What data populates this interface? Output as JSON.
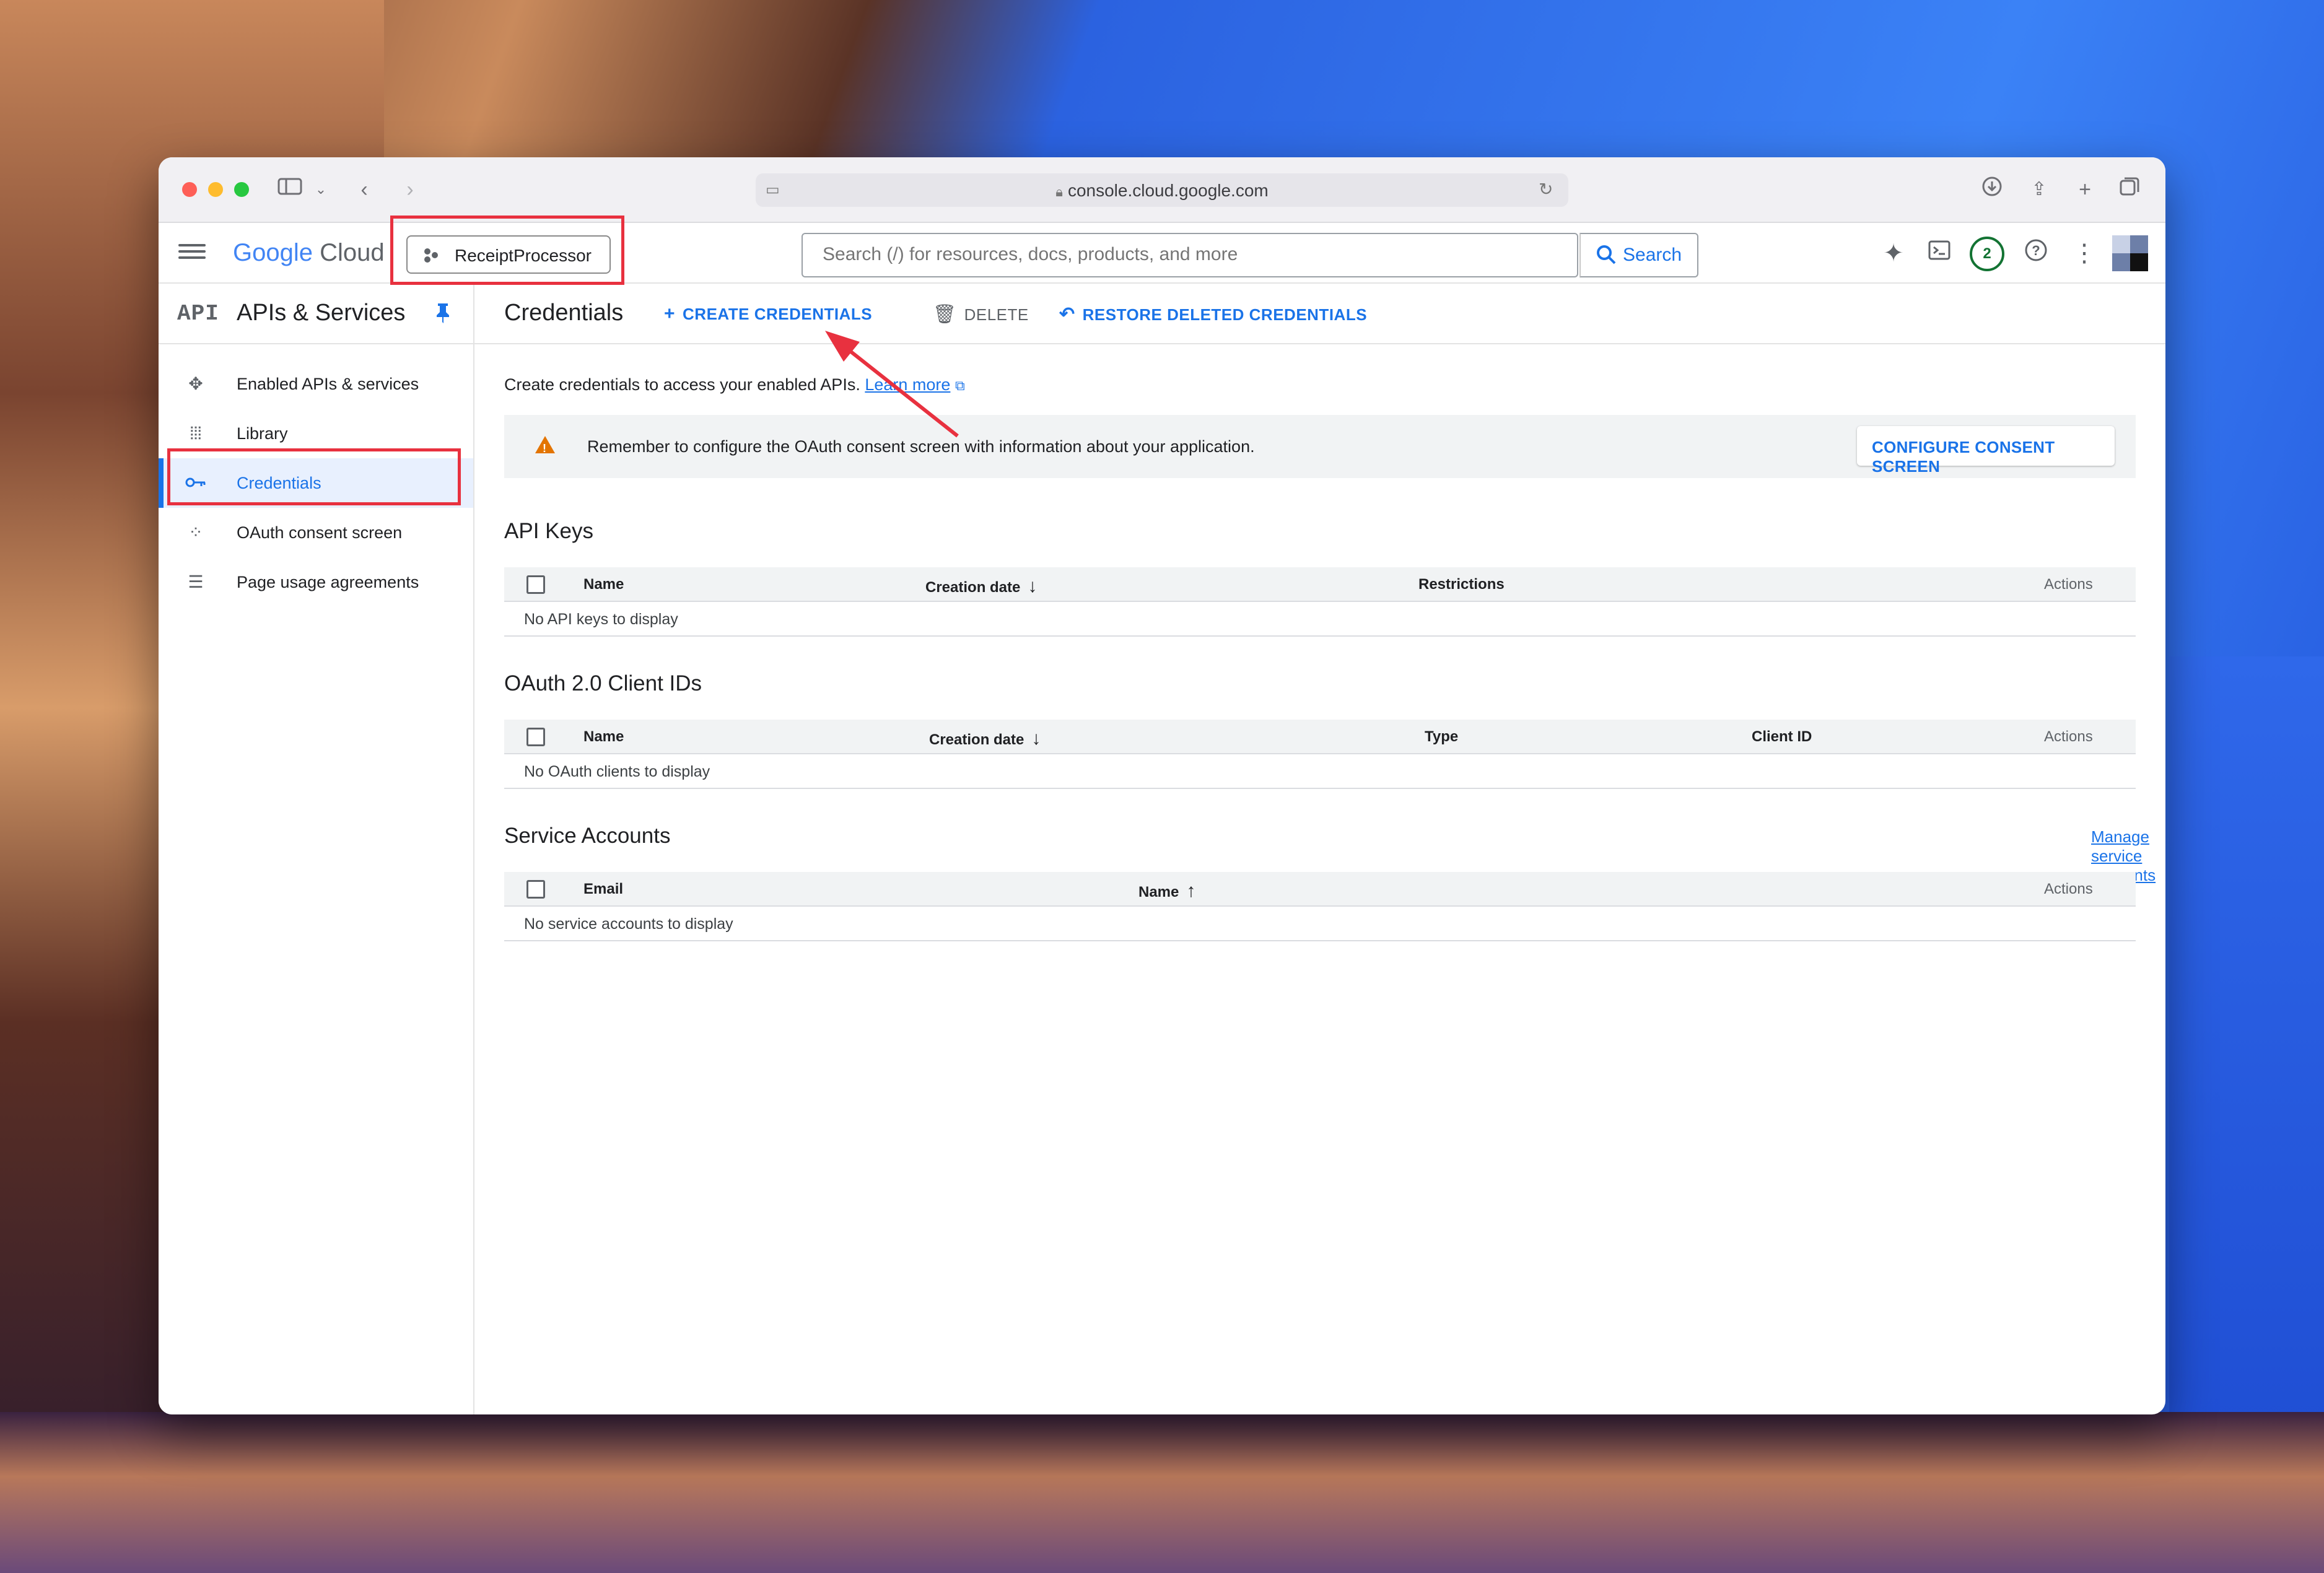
{
  "browser": {
    "url": "console.cloud.google.com",
    "icons": [
      "sidebar-toggle-icon",
      "chevron-down-icon",
      "back-icon",
      "forward-icon",
      "download-icon",
      "share-icon",
      "new-tab-icon",
      "tabs-icon"
    ]
  },
  "header": {
    "logo_google": "Google",
    "logo_cloud": "Cloud",
    "project": "ReceiptProcessor",
    "search_placeholder": "Search (/) for resources, docs, products, and more",
    "search_button": "Search",
    "notification_count": "2"
  },
  "sidebar": {
    "api_badge": "API",
    "title": "APIs & Services",
    "items": [
      {
        "label": "Enabled APIs & services",
        "icon": "enabled-apis-icon"
      },
      {
        "label": "Library",
        "icon": "library-icon"
      },
      {
        "label": "Credentials",
        "icon": "key-icon",
        "active": true
      },
      {
        "label": "OAuth consent screen",
        "icon": "consent-icon"
      },
      {
        "label": "Page usage agreements",
        "icon": "settings-list-icon"
      }
    ],
    "collapse": "<|"
  },
  "main": {
    "title": "Credentials",
    "actions": {
      "create": "CREATE CREDENTIALS",
      "delete": "DELETE",
      "restore": "RESTORE DELETED CREDENTIALS"
    },
    "intro_text": "Create credentials to access your enabled APIs.",
    "learn_more": "Learn more",
    "notice_text": "Remember to configure the OAuth consent screen with information about your application.",
    "configure_button": "CONFIGURE CONSENT SCREEN",
    "api_keys": {
      "title": "API Keys",
      "columns": [
        "Name",
        "Creation date",
        "Restrictions",
        "Actions"
      ],
      "empty": "No API keys to display"
    },
    "oauth": {
      "title": "OAuth 2.0 Client IDs",
      "columns": [
        "Name",
        "Creation date",
        "Type",
        "Client ID",
        "Actions"
      ],
      "empty": "No OAuth clients to display"
    },
    "service_accounts": {
      "title": "Service Accounts",
      "manage_link": "Manage service accounts",
      "columns": [
        "Email",
        "Name",
        "Actions"
      ],
      "empty": "No service accounts to display"
    }
  },
  "colors": {
    "accent": "#1a73e8",
    "annotation": "#e8313f",
    "warning": "#e37400"
  }
}
